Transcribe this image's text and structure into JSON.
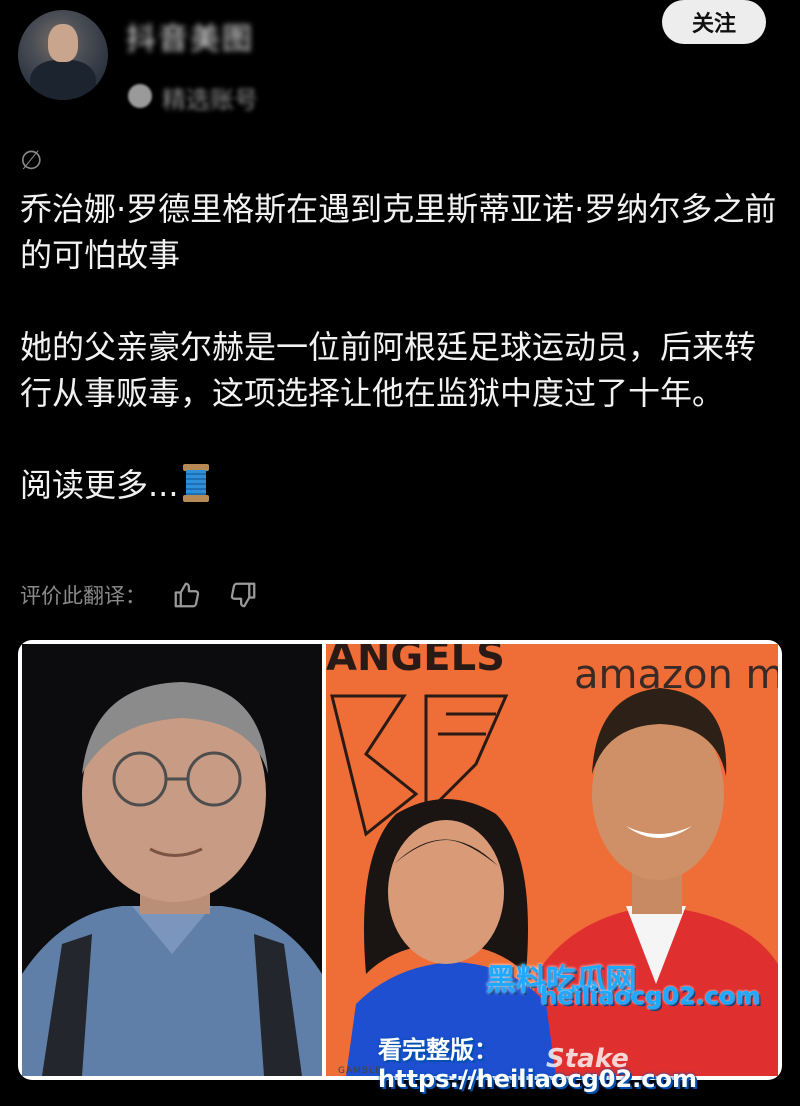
{
  "user": {
    "name": "抖音美图",
    "handle": "精选账号"
  },
  "header": {
    "follow_label": "关注"
  },
  "post": {
    "paragraphs": [
      "乔治娜·罗德里格斯在遇到克里斯蒂亚诺·罗纳尔多之前的可怕故事",
      "她的父亲豪尔赫是一位前阿根廷足球运动员，后来转行从事贩毒，这项选择让他在监狱中度过了十年。"
    ],
    "read_more": "阅读更多..."
  },
  "translation": {
    "rate_label": "评价此翻译："
  },
  "image": {
    "sign_angels": "ANGELS",
    "sign_amazon": "amazon m",
    "gamble_text": "GAMBLE",
    "stake_text": "Stake"
  },
  "watermark": {
    "title": "黑料吃瓜网",
    "url": "heiliaocg02.com",
    "full_url": "看完整版： https://heiliaocg02.com"
  },
  "icons": {
    "null": "null-icon",
    "spool": "spool-icon",
    "thumb_up": "thumbs-up-icon",
    "thumb_down": "thumbs-down-icon"
  },
  "colors": {
    "background": "#000000",
    "text": "#f2f2f2",
    "muted": "#8a8a8a",
    "follow_bg": "#ededed",
    "watermark_blue": "#1fa8ff",
    "photo_orange": "#f0703a"
  }
}
